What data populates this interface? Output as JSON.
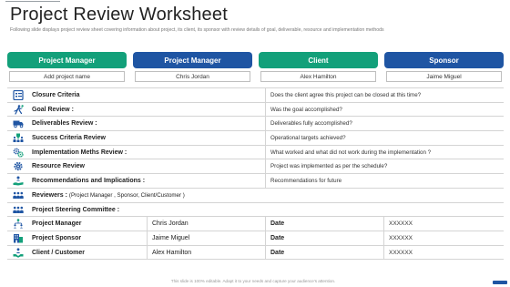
{
  "page": {
    "title": "Project Review Worksheet",
    "subtitle": "Following slide displays project review sheet covering information about project, its client, its sponsor with review details of goal, deliverable, resource and implementation methods"
  },
  "cards": [
    {
      "header": "Project Manager",
      "value": "Add project name",
      "color": "#13a07a"
    },
    {
      "header": "Project Manager",
      "value": "Chris Jordan",
      "color": "#1f55a3"
    },
    {
      "header": "Client",
      "value": "Alex Hamilton",
      "color": "#13a07a"
    },
    {
      "header": "Sponsor",
      "value": "Jaime Miguel",
      "color": "#1f55a3"
    }
  ],
  "review_rows": [
    {
      "icon": "checklist-icon",
      "label": "Closure Criteria",
      "answer": "Does the client agree this project can be closed at this time?"
    },
    {
      "icon": "runner-goal-icon",
      "label": "Goal Review :",
      "answer": "Was the goal accomplished?"
    },
    {
      "icon": "delivery-truck-icon",
      "label": "Deliverables Review :",
      "answer": "Deliverables fully accomplished?"
    },
    {
      "icon": "trophy-people-icon",
      "label": "Success Criteria Review",
      "answer": "Operational targets achieved?"
    },
    {
      "icon": "gears-icon",
      "label": "Implementation Meths Review :",
      "answer": "What worked and what did not work during the implementation ?"
    },
    {
      "icon": "cog-icon",
      "label": "Resource Review",
      "answer": "Project was implemented as per the schedule?"
    },
    {
      "icon": "hand-person-icon",
      "label": "Recommendations and Implications :",
      "answer": "Recommendations for future"
    }
  ],
  "reviewers": {
    "label": "Reviewers :",
    "note": "(Project Manager , Sponsor, Client/Customer )"
  },
  "steering": {
    "label": "Project Steering Committee :"
  },
  "people_rows": [
    {
      "icon": "org-chart-icon",
      "role": "Project Manager",
      "name": "Chris Jordan",
      "date_label": "Date",
      "date": "XXXXXX"
    },
    {
      "icon": "building-icon",
      "role": "Project Sponsor",
      "name": "Jaime Miguel",
      "date_label": "Date",
      "date": "XXXXXX"
    },
    {
      "icon": "handshake-icon",
      "role": "Client / Customer",
      "name": "Alex Hamilton",
      "date_label": "Date",
      "date": "XXXXXX"
    }
  ],
  "footer": "This slide is 100% editable. Adapt it to your needs and capture your audience's attention.",
  "colors": {
    "accent_green": "#13a07a",
    "accent_blue": "#1f55a3",
    "icon_blue": "#1f55a3"
  }
}
